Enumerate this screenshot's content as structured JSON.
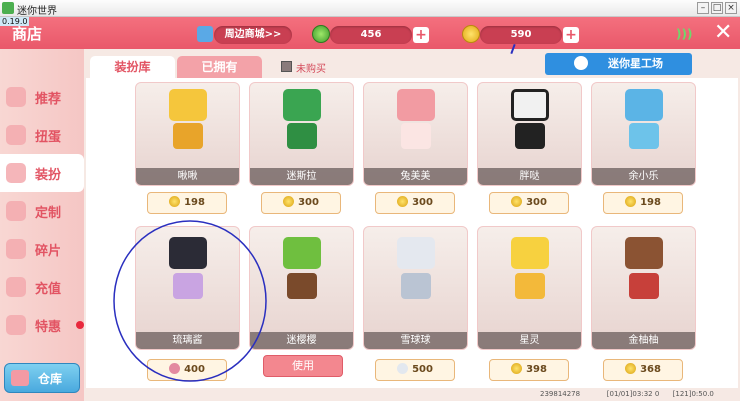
{
  "window": {
    "title": "迷你世界",
    "version": "0.19.0"
  },
  "header": {
    "title": "商店",
    "nearby_mall": "周边商城>>",
    "gems": "456",
    "coins": "590"
  },
  "tabs": [
    {
      "label": "装扮库",
      "active": true
    },
    {
      "label": "已拥有",
      "active": false
    },
    {
      "label": "未购买",
      "active": false
    }
  ],
  "workshop_button": "迷你星工场",
  "sidebar": {
    "items": [
      {
        "label": "推荐",
        "active": false
      },
      {
        "label": "扭蛋",
        "active": false
      },
      {
        "label": "装扮",
        "active": true
      },
      {
        "label": "定制",
        "active": false
      },
      {
        "label": "碎片",
        "active": false
      },
      {
        "label": "充值",
        "active": false
      },
      {
        "label": "特惠",
        "active": false
      }
    ],
    "warehouse": "仓库"
  },
  "items": [
    {
      "name": "啾啾",
      "price": "198",
      "kind": "coin"
    },
    {
      "name": "迷斯拉",
      "price": "300",
      "kind": "coin"
    },
    {
      "name": "兔美美",
      "price": "300",
      "kind": "coin"
    },
    {
      "name": "胖哒",
      "price": "300",
      "kind": "coin"
    },
    {
      "name": "余小乐",
      "price": "198",
      "kind": "coin"
    },
    {
      "name": "琉璃酱",
      "price": "400",
      "kind": "fragment"
    },
    {
      "name": "迷樱樱",
      "price": "使用",
      "kind": "use"
    },
    {
      "name": "雪球球",
      "price": "500",
      "kind": "fragment"
    },
    {
      "name": "星灵",
      "price": "398",
      "kind": "coin"
    },
    {
      "name": "金柚柚",
      "price": "368",
      "kind": "coin"
    }
  ],
  "footer": {
    "id": "239814278",
    "date": "[01/01]03:32 0",
    "stats": "[121]0:50.0"
  },
  "colors": {
    "header": "#ec5f70",
    "accent": "#e25463",
    "annotation": "#2a2fbf"
  }
}
